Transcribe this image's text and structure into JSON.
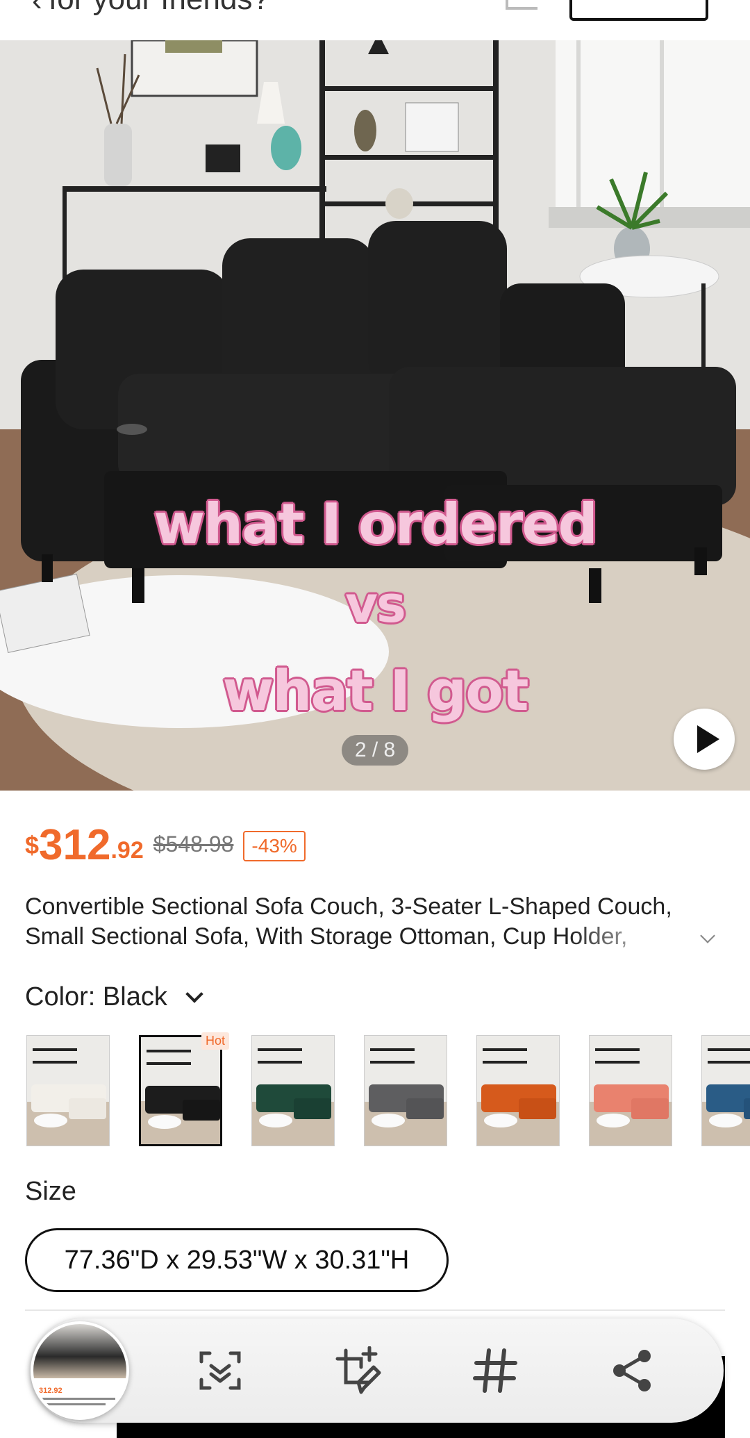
{
  "top_bar": {
    "search_text": "for your friends?",
    "back_icon": "chevron-left-icon",
    "cart_icon": "cart-icon"
  },
  "hero": {
    "overlay_lines": [
      "what I ordered",
      "vs",
      "what I got"
    ],
    "pager": "2 / 8",
    "play_icon": "play-icon"
  },
  "product": {
    "currency": "$",
    "price_int": "312",
    "price_dec": ".92",
    "original_price": "$548.98",
    "discount": "-43%",
    "title": "Convertible Sectional Sofa Couch, 3-Seater L-Shaped Couch, Small Sectional Sofa, With Storage Ottoman, Cup Holder,"
  },
  "color": {
    "label": "Color: Black",
    "hot_badge": "Hot",
    "swatches": [
      {
        "name": "white",
        "color": "#f2efe9",
        "selected": false
      },
      {
        "name": "black",
        "color": "#1c1c1c",
        "selected": true
      },
      {
        "name": "green",
        "color": "#1f4a3a",
        "selected": false
      },
      {
        "name": "gray",
        "color": "#5e5e60",
        "selected": false
      },
      {
        "name": "orange",
        "color": "#d65a1c",
        "selected": false
      },
      {
        "name": "pink",
        "color": "#e9826e",
        "selected": false
      },
      {
        "name": "blue",
        "color": "#2a5c86",
        "selected": false
      }
    ]
  },
  "size": {
    "label": "Size",
    "selected": "77.36\"D x 29.53\"W x 30.31\"H"
  },
  "screenshot_toolbar": {
    "tools": [
      "scan-icon",
      "crop-edit-icon",
      "hashtag-icon",
      "share-icon"
    ]
  },
  "colors": {
    "accent": "#f06a2b",
    "overlay_text": "#f6c7dd",
    "overlay_outline": "#d15a8f"
  }
}
